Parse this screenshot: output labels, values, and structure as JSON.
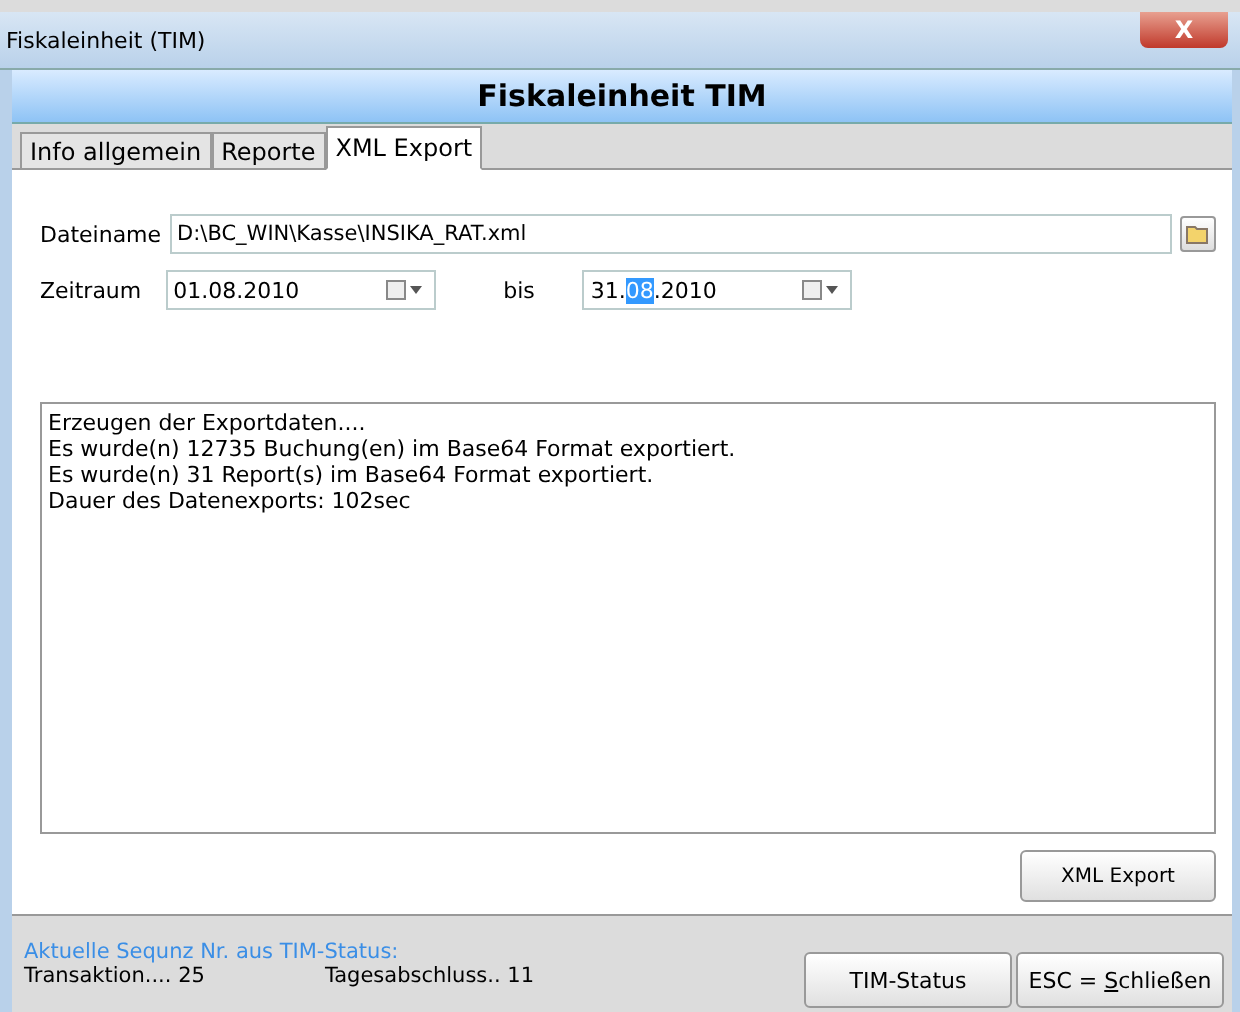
{
  "window": {
    "title": "Fiskaleinheit (TIM)",
    "close": "X"
  },
  "header": {
    "title": "Fiskaleinheit TIM"
  },
  "tabs": [
    {
      "label": "Info allgemein",
      "selected": false
    },
    {
      "label": "Reporte",
      "selected": false
    },
    {
      "label": "XML Export",
      "selected": true
    }
  ],
  "filename": {
    "label": "Dateiname",
    "value": "D:\\BC_WIN\\Kasse\\INSIKA_RAT.xml"
  },
  "period": {
    "label": "Zeitraum",
    "from": {
      "before": "01.08.2010"
    },
    "separator": "bis",
    "to": {
      "before": "31.",
      "selected": "08",
      "after": ".2010"
    }
  },
  "log": [
    "Erzeugen der Exportdaten....",
    "Es wurde(n) 12735 Buchung(en) im Base64 Format exportiert.",
    "Es wurde(n) 31 Report(s) im Base64 Format exportiert.",
    "Dauer des Datenexports: 102sec"
  ],
  "export_button": "XML Export",
  "status": {
    "caption": "Aktuelle Sequnz Nr. aus TIM-Status:",
    "transaction": "Transaktion.... 25",
    "closing": "Tagesabschluss.. 11"
  },
  "buttons": [
    {
      "before": "TIM-Status"
    },
    {
      "before": "ESC = ",
      "access_key": "S",
      "after": "chließen"
    }
  ]
}
